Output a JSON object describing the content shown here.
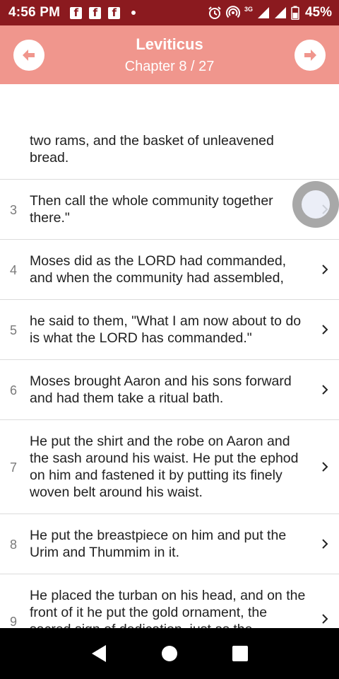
{
  "status_bar": {
    "time": "4:56 PM",
    "network": "3G",
    "battery": "45%",
    "notification_icons": [
      "facebook-icon",
      "facebook-icon",
      "facebook-icon"
    ]
  },
  "header": {
    "title": "Leviticus",
    "subtitle": "Chapter 8 / 27",
    "prev_icon": "arrow-left-icon",
    "next_icon": "arrow-right-icon",
    "background": "#f0968d"
  },
  "verses": [
    {
      "num": "",
      "text": "two rams, and the basket of unleavened bread."
    },
    {
      "num": "3",
      "text": "Then call the whole community together there.\""
    },
    {
      "num": "4",
      "text": "Moses did as the LORD had commanded, and when the community had assembled,"
    },
    {
      "num": "5",
      "text": "he said to them, \"What I am now about to do is what the LORD has commanded.\""
    },
    {
      "num": "6",
      "text": "Moses brought Aaron and his sons forward and had them take a ritual bath."
    },
    {
      "num": "7",
      "text": "He put the shirt and the robe on Aaron and the sash around his waist. He put the ephod on him and fastened it by putting its finely woven belt around his waist."
    },
    {
      "num": "8",
      "text": "He put the breastpiece on him and put the Urim and Thummim in it."
    },
    {
      "num": "9",
      "text": "He placed the turban on his head, and on the front of it he put the gold ornament, the sacred sign of dedication, just as the"
    }
  ],
  "colors": {
    "status_bar": "#8b1a1f",
    "header": "#f0968d",
    "nav_bar": "#000000"
  }
}
